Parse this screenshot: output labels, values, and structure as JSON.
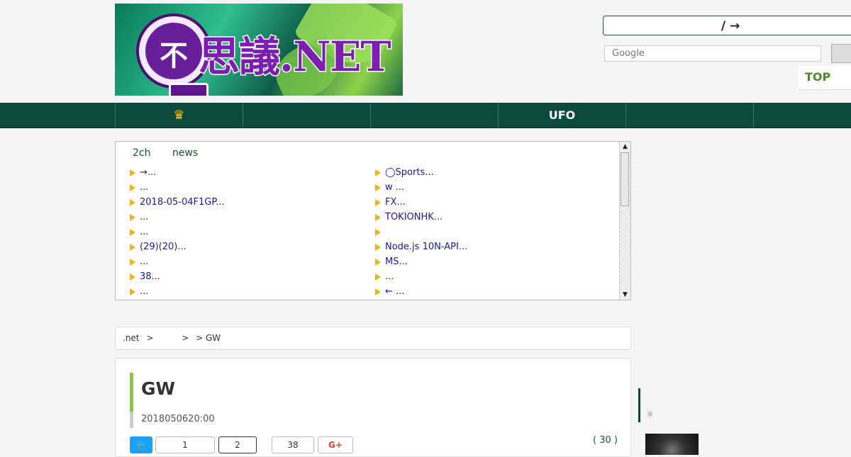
{
  "logo": {
    "text": "思議.NET",
    "mark": "不"
  },
  "header": {
    "lang_switch": "/ →",
    "search_placeholder": "Google",
    "top_link": "TOP"
  },
  "nav": {
    "items": [
      "",
      "",
      "",
      "UFO",
      "",
      ""
    ]
  },
  "news": {
    "tabs": [
      "2ch",
      "news"
    ],
    "left": [
      "→...",
      "...",
      "2018-05-04F1GP...",
      "...",
      "...",
      "(29)(20)...",
      "...",
      "38...",
      "..."
    ],
    "right": [
      "◯Sports...",
      "w ...",
      "FX...",
      "TOKIONHK...",
      "",
      "Node.js 10N-API...",
      "MS...",
      "...",
      "← ..."
    ]
  },
  "breadcrumb": {
    "site": ".net",
    "sep1": ">",
    "sep2": ">",
    "current": "> GW"
  },
  "article": {
    "title": "GW",
    "date": "2018050620:00",
    "share_counts": [
      "1",
      "2",
      "38"
    ],
    "gplus": "G+",
    "comments": "( 30 )"
  },
  "sidebar": {
    "note": "※"
  },
  "colors": {
    "nav_bg": "#0b4a3c",
    "accent": "#8bc34a",
    "link": "#1a1a9a"
  }
}
